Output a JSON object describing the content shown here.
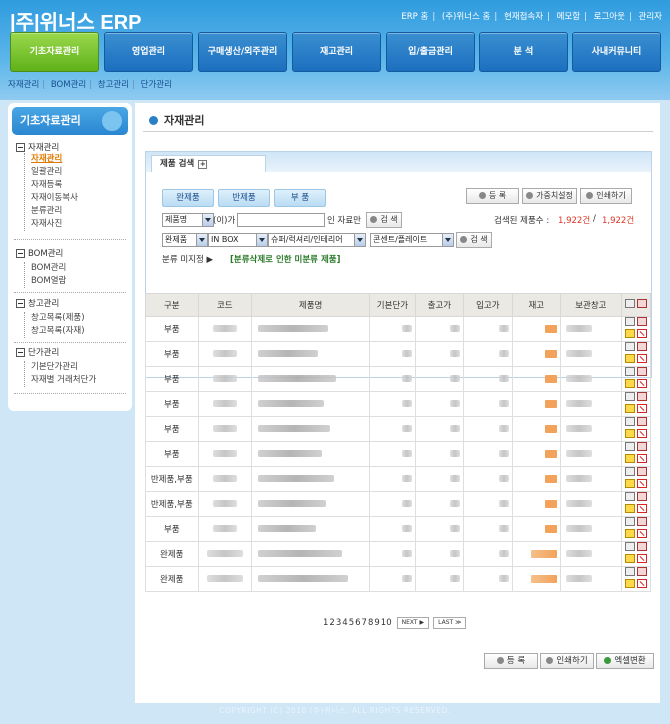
{
  "header": {
    "logo": "|주|위너스 ERP",
    "toplinks": [
      "ERP 홈",
      "(주)위너스 홈",
      "현재접속자",
      "메모함",
      "로그아웃",
      "관리자"
    ]
  },
  "nav": [
    "기초자료관리",
    "영업관리",
    "구매생산/외주관리",
    "재고관리",
    "입/출금관리",
    "분  석",
    "사내커뮤니티"
  ],
  "subnav": [
    "자재관리",
    "BOM관리",
    "창고관리",
    "단가관리"
  ],
  "sidebar": {
    "title": "기초자료관리",
    "groups": [
      {
        "label": "자재관리",
        "items": [
          "자재관리",
          "일괄관리",
          "자재등록",
          "자재이동복사",
          "분류관리",
          "자재사진"
        ]
      },
      {
        "label": "BOM관리",
        "items": [
          "BOM관리",
          "BOM열람"
        ]
      },
      {
        "label": "창고관리",
        "items": [
          "창고목록(제품)",
          "창고목록(자재)"
        ]
      },
      {
        "label": "단가관리",
        "items": [
          "기본단가관리",
          "자재별 거래처단가"
        ]
      }
    ]
  },
  "main": {
    "title": "자재관리",
    "search_tab": "제품 검색",
    "type_buttons": [
      "완제품",
      "반제품",
      "부  품"
    ],
    "actions": {
      "register": "등  록",
      "supplier": "가중치설정",
      "print": "인쇄하기"
    },
    "search_field": "제품명",
    "search_suffix": "(이)가",
    "search_suffix2": "인 자료만",
    "search_btn": "검 색",
    "count_label": "검색된 제품수 :",
    "count_found": "1,922건",
    "count_sep": "/",
    "count_total": "1,922건",
    "filters": [
      "완제품",
      "IN BOX",
      "슈퍼/럭셔리/인테리어",
      "콘센트/플레이트"
    ],
    "filter_btn": "검 색",
    "unclassified_label": "분류 미지정 ▶",
    "unclassified_link": "[분류삭제로 인한 미분류 제품]"
  },
  "table": {
    "headers": [
      "구분",
      "코드",
      "제품명",
      "기본단가",
      "출고가",
      "입고가",
      "재고",
      "보관창고"
    ],
    "rows": [
      "부품",
      "부품",
      "부품",
      "부품",
      "부품",
      "부품",
      "반제품,부품",
      "반제품,부품",
      "부품",
      "완제품",
      "완제품"
    ]
  },
  "pager": {
    "pages": [
      "1",
      "2",
      "3",
      "4",
      "5",
      "6",
      "7",
      "8",
      "9",
      "10"
    ],
    "next": "NEXT ▶",
    "last": "LAST ≫"
  },
  "footer_buttons": {
    "register": "등  록",
    "print": "인쇄하기",
    "excel": "엑셀변환"
  },
  "copyright": "COPYRIGHT (C) 2010 (주)위너스. ALL RIGHTS RESERVED."
}
